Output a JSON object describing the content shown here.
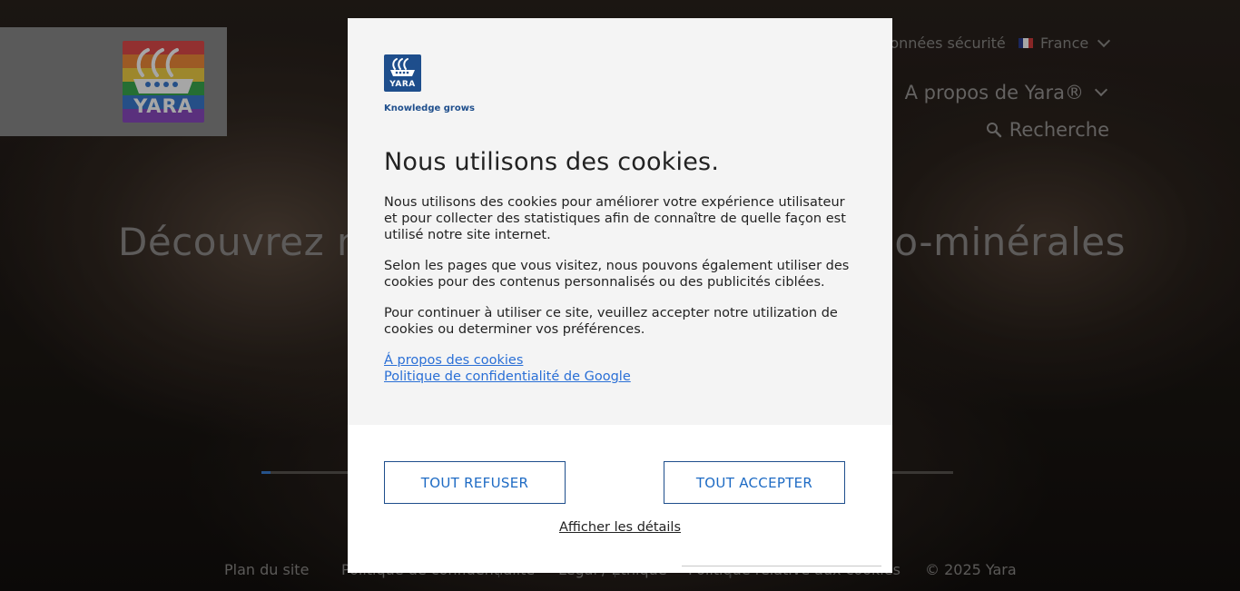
{
  "background": {
    "logo": {
      "word": "YARA"
    },
    "top_links": {
      "safety": "Données sécurité",
      "language": "France"
    },
    "nav": {
      "about": "A propos de Yara®",
      "search": "Recherche"
    },
    "hero": {
      "title_left": "Découvrez no",
      "title_right": "no-minérales"
    },
    "footer": {
      "sitemap": "Plan du site",
      "privacy": "Politique de confidentialité",
      "legal": "Légal / Ethique",
      "cookies": "Politique relative aux cookies",
      "copyright": "© 2025 Yara"
    }
  },
  "modal": {
    "brand": {
      "mark_word": "YARA",
      "tagline": "Knowledge grows"
    },
    "title": "Nous utilisons des cookies.",
    "paragraphs": [
      "Nous utilisons des cookies pour améliorer votre expérience utilisateur et pour collecter des statistiques afin de connaître de quelle façon est utilisé notre site internet.",
      "Selon les pages que vous visitez, nous pouvons également utiliser des cookies pour des contenus personnalisés ou des publicités ciblées.",
      "Pour continuer à utiliser ce site, veuillez accepter notre utilization de cookies ou determiner vos préférences."
    ],
    "links": {
      "about_cookies": "Á propos des cookies",
      "google_privacy": "Politique de confidentialité de Google"
    },
    "buttons": {
      "refuse": "TOUT REFUSER",
      "accept": "TOUT ACCEPTER"
    },
    "details": "Afficher les détails"
  },
  "colors": {
    "brand_blue": "#1e4e8c",
    "link_blue": "#2a6fd6",
    "button_text": "#1e6bc4"
  }
}
